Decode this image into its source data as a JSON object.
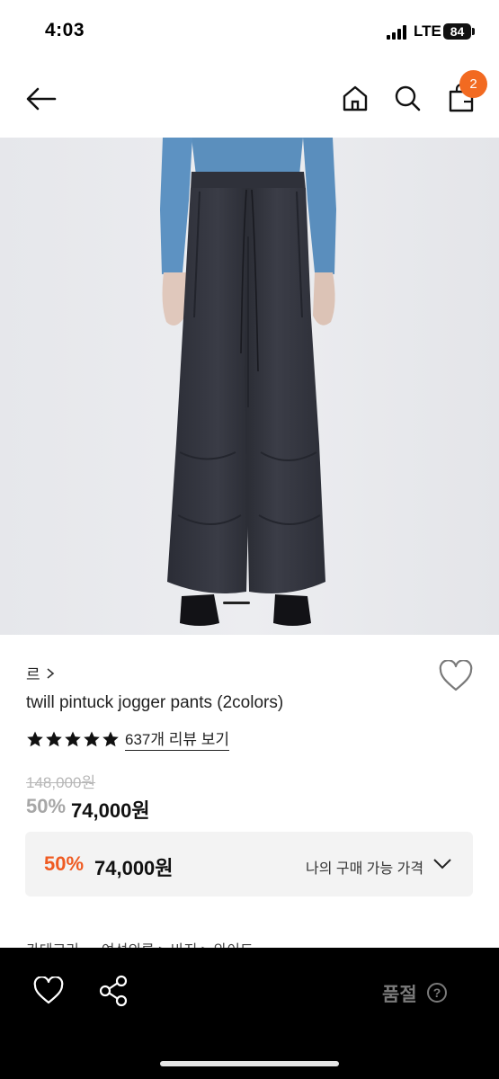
{
  "status_bar": {
    "time": "4:03",
    "network": "LTE",
    "battery": "84"
  },
  "nav": {
    "icons": [
      "back-arrow-icon",
      "home-icon",
      "search-icon",
      "shopping-bag-icon"
    ],
    "cart_count": "2",
    "badge_color": "#f26a21"
  },
  "product": {
    "image": "dark-navy-twill-pintuck-jogger-pants-photo",
    "brand": "르",
    "name": "twill pintuck jogger pants (2colors)",
    "stars": 5,
    "review_link": "637개 리뷰 보기",
    "original_price": "148,000원",
    "discount": "50%",
    "price": "74,000원"
  },
  "my_price": {
    "discount": "50%",
    "price": "74,000원",
    "label": "나의 구매 가능 가격",
    "accent_color": "#ef5b22"
  },
  "category_peek": "카테고리 　 여성의류 > 바지 > 와이드",
  "bottom_bar": {
    "icons": [
      "heart-outline-icon",
      "share-icon",
      "question-circle-icon"
    ],
    "soldout_label": "품절",
    "help_glyph": "?"
  }
}
